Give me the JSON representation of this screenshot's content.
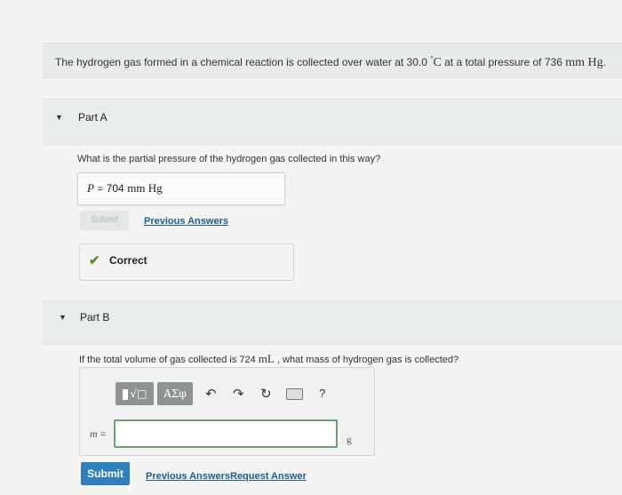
{
  "intro": {
    "text_before": "The hydrogen gas formed in a chemical reaction is collected over water at 30.0 ",
    "degree": "°",
    "temp_unit": "C",
    "text_mid": " at a total pressure of 736 ",
    "pressure_unit": "mm Hg",
    "text_after": "."
  },
  "partA": {
    "title": "Part A",
    "question": "What is the partial pressure of the hydrogen gas collected in this way?",
    "answer_var": "P",
    "answer_eq": "=",
    "answer_value": "704",
    "answer_unit": "mm Hg",
    "submit_label": "Submit",
    "previous_answers_label": "Previous Answers",
    "feedback_icon": "check-icon",
    "feedback_label": "Correct",
    "feedback_color": "#5a8f29"
  },
  "partB": {
    "title": "Part B",
    "question_before": "If the total volume of gas collected is 724 ",
    "question_unit": "mL",
    "question_after": " , what mass of hydrogen gas is collected?",
    "toolbar": {
      "templates_icon": "fraction-root-template-icon",
      "greek_label": "ΑΣφ",
      "undo_icon": "undo-icon",
      "redo_icon": "redo-icon",
      "reset_icon": "reset-icon",
      "keyboard_icon": "keyboard-icon",
      "help_label": "?"
    },
    "input_var": "m",
    "input_eq": "=",
    "input_value": "",
    "input_unit": "g",
    "submit_label": "Submit",
    "previous_answers_label": "Previous Answers",
    "request_answer_label": "Request Answer"
  },
  "colors": {
    "accent": "#2f7fbf",
    "link": "#1d5b92",
    "input_border": "#6f9f70"
  }
}
